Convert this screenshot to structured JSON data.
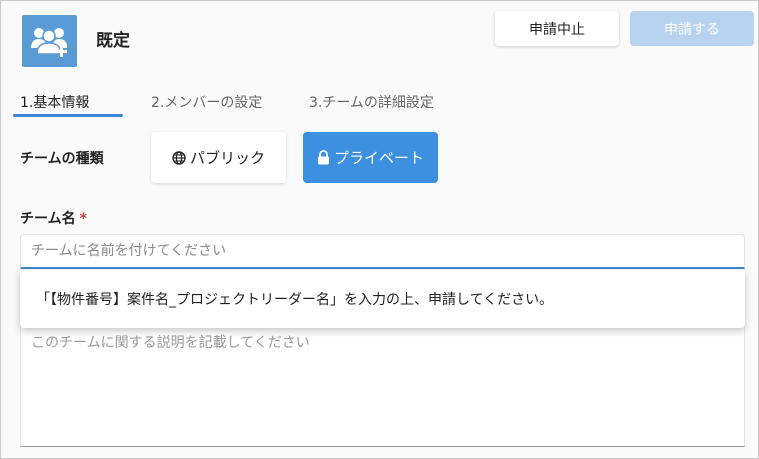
{
  "header": {
    "title": "既定",
    "icon": "team-add-icon",
    "cancel_label": "申請中止",
    "apply_label": "申請する"
  },
  "tabs": [
    {
      "label": "1.基本情報",
      "active": true
    },
    {
      "label": "2.メンバーの設定",
      "active": false
    },
    {
      "label": "3.チームの詳細設定",
      "active": false
    }
  ],
  "team_type": {
    "label": "チームの種類",
    "options": [
      {
        "label": "パブリック",
        "icon": "globe-icon",
        "selected": false
      },
      {
        "label": "プライベート",
        "icon": "lock-icon",
        "selected": true
      }
    ]
  },
  "team_name": {
    "label": "チーム名",
    "required_mark": "*",
    "value": "",
    "placeholder": "チームに名前を付けてください"
  },
  "hint": {
    "text": "「【物件番号】案件名_プロジェクトリーダー名」を入力の上、申請してください。"
  },
  "description": {
    "value": "",
    "placeholder": "このチームに関する説明を記載してください"
  },
  "colors": {
    "accent": "#3d87d6",
    "apply_disabled": "#b8d3f0",
    "private_selected": "#3d8fe0",
    "required": "#d9363e",
    "icon_bg": "#5b9bd5"
  }
}
